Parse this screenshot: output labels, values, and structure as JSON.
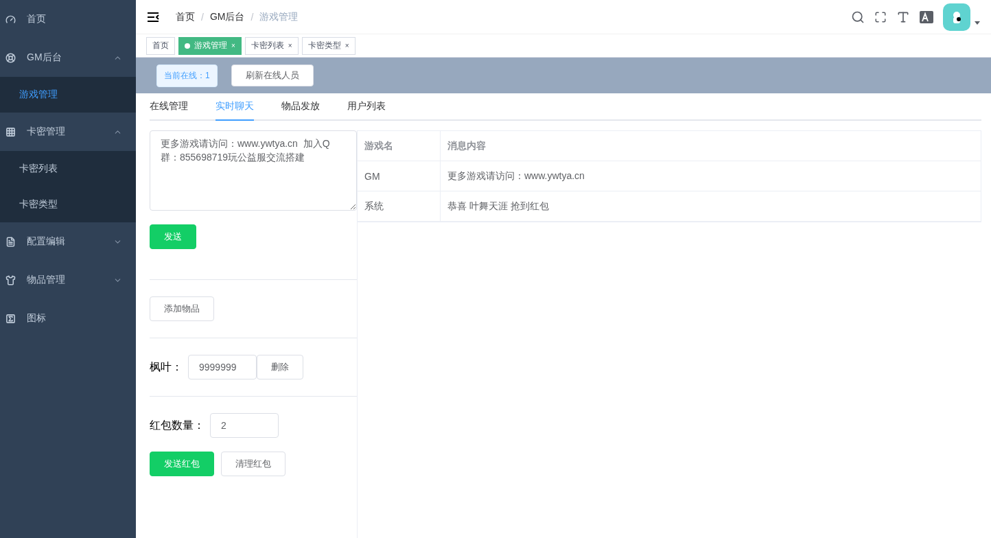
{
  "sidebar": {
    "items": [
      {
        "label": "首页",
        "selected": false
      },
      {
        "label": "GM后台",
        "expanded": true,
        "children": [
          {
            "label": "游戏管理",
            "selected": true
          }
        ]
      },
      {
        "label": "卡密管理",
        "expanded": true,
        "children": [
          {
            "label": "卡密列表",
            "selected": false
          },
          {
            "label": "卡密类型",
            "selected": false
          }
        ]
      },
      {
        "label": "配置编辑",
        "expanded": false
      },
      {
        "label": "物品管理",
        "expanded": false
      },
      {
        "label": "图标",
        "selected": false
      }
    ]
  },
  "breadcrumb": [
    {
      "label": "首页",
      "current": false
    },
    {
      "separator": "/",
      "label": "GM后台",
      "current": false
    },
    {
      "separator": "/",
      "label": "游戏管理",
      "current": true
    }
  ],
  "tags": [
    {
      "label": "首页",
      "selected": false
    },
    {
      "label": "游戏管理",
      "selected": true,
      "close": "×"
    },
    {
      "label": "卡密列表",
      "selected": false,
      "close": "×"
    },
    {
      "label": "卡密类型",
      "selected": false,
      "close": "×"
    }
  ],
  "online_bar": {
    "count_tag": "当前在线：1",
    "refresh_button": "刷新在线人员"
  },
  "tabs": [
    {
      "label": "在线管理",
      "selected": false
    },
    {
      "label": "实时聊天",
      "selected": true
    },
    {
      "label": "物品发放",
      "selected": false
    },
    {
      "label": "用户列表",
      "selected": false
    }
  ],
  "chat": {
    "message_value": "更多游戏请访问：www.ywtya.cn  加入Q群：855698719玩公益服交流搭建",
    "send_button": "发送"
  },
  "items": {
    "add_button": "添加物品",
    "rows": [
      {
        "label": "枫叶：",
        "value": "9999999",
        "delete_button": "删除"
      }
    ]
  },
  "red_packet": {
    "label": "红包数量：",
    "value": "2",
    "send_button": "发送红包",
    "clear_button": "清理红包"
  },
  "table": {
    "columns": [
      "游戏名",
      "消息内容"
    ],
    "rows": [
      [
        "GM",
        "更多游戏请访问：www.ywtya.cn"
      ],
      [
        "系统",
        "恭喜 叶舞天涯 抢到红包"
      ]
    ]
  }
}
